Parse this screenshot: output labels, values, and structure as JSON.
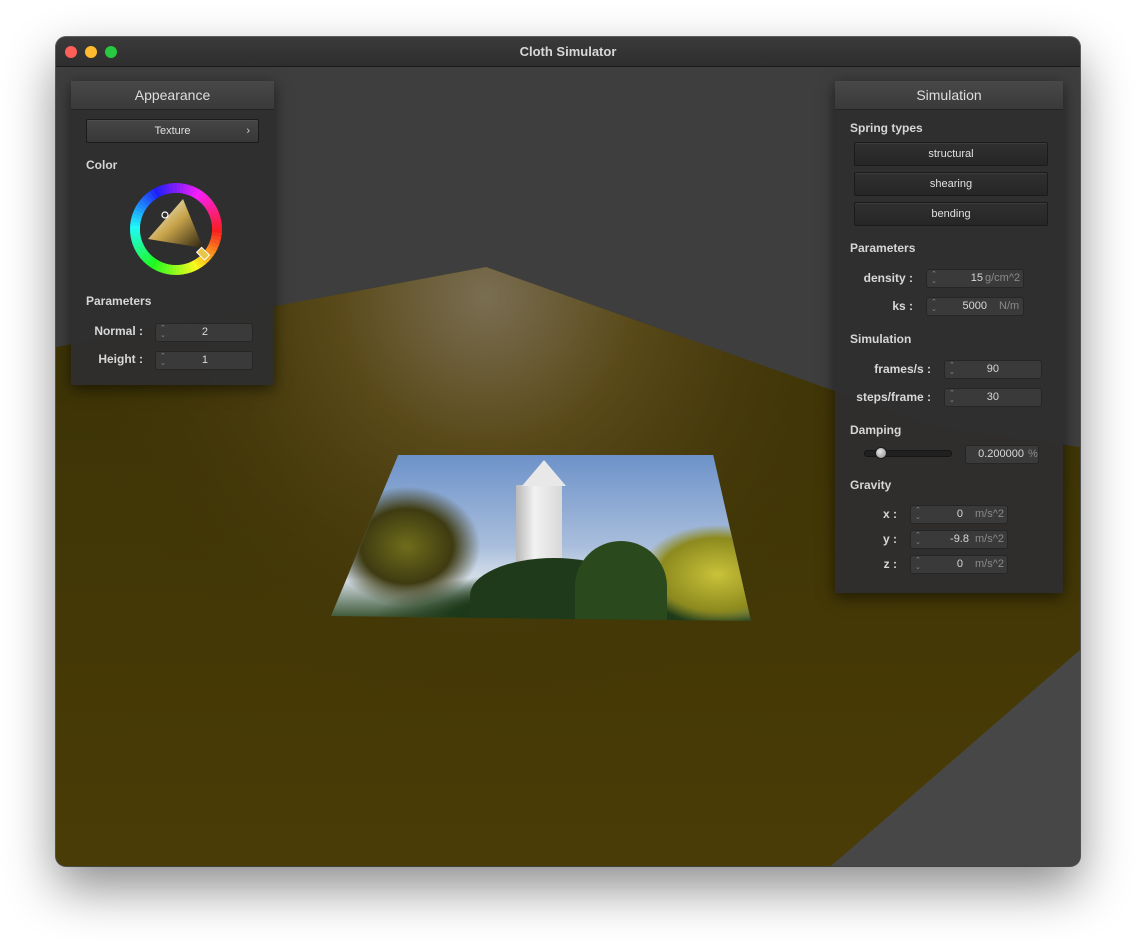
{
  "window": {
    "title": "Cloth Simulator"
  },
  "appearance": {
    "header": "Appearance",
    "shader_combo": "Texture",
    "color_label": "Color",
    "parameters_label": "Parameters",
    "normal": {
      "label": "Normal :",
      "value": "2"
    },
    "height": {
      "label": "Height :",
      "value": "1"
    }
  },
  "simulation": {
    "header": "Simulation",
    "spring_types_label": "Spring types",
    "springs": [
      "structural",
      "shearing",
      "bending"
    ],
    "parameters_label": "Parameters",
    "density": {
      "label": "density :",
      "value": "15",
      "unit": "g/cm^2"
    },
    "ks": {
      "label": "ks :",
      "value": "5000",
      "unit": "N/m"
    },
    "simulation_label": "Simulation",
    "fps": {
      "label": "frames/s :",
      "value": "90"
    },
    "steps": {
      "label": "steps/frame :",
      "value": "30"
    },
    "damping_label": "Damping",
    "damping": {
      "value": "0.200000",
      "unit": "%",
      "fraction": 0.2
    },
    "gravity_label": "Gravity",
    "gx": {
      "label": "x :",
      "value": "0",
      "unit": "m/s^2"
    },
    "gy": {
      "label": "y :",
      "value": "-9.8",
      "unit": "m/s^2"
    },
    "gz": {
      "label": "z :",
      "value": "0",
      "unit": "m/s^2"
    }
  },
  "colors": {
    "ground": "#4a3c06",
    "background": "#3e3e3e",
    "panel": "#2e2e2e"
  }
}
